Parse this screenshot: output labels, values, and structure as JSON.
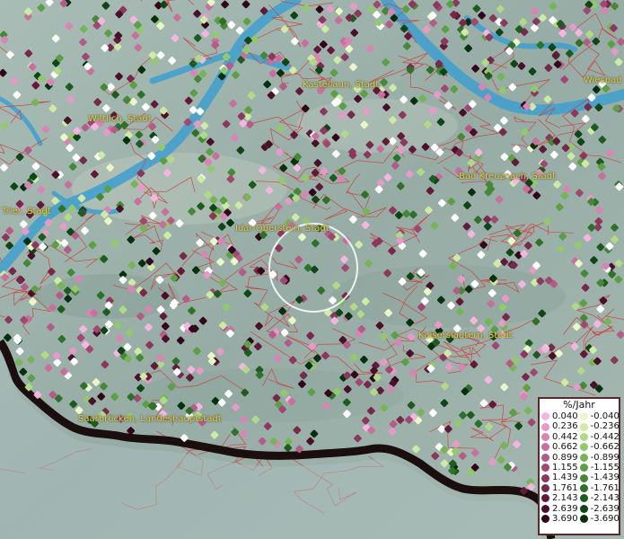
{
  "map": {
    "cities": [
      {
        "label": "Kastellaun, Stadt",
        "name": "city-kastellaun"
      },
      {
        "label": "Wiesbad",
        "name": "city-wiesbaden"
      },
      {
        "label": "Wittlich, Stadt",
        "name": "city-wittlich"
      },
      {
        "label": "Bad Kreuznach, Stadt",
        "name": "city-bad-kreuznach"
      },
      {
        "label": "Trier, Stadt",
        "name": "city-trier"
      },
      {
        "label": "Idar-Oberstein, Stadt",
        "name": "city-idar-oberstein"
      },
      {
        "label": "Kaiserslautern, Stadt",
        "name": "city-kaiserslautern"
      },
      {
        "label": "Saarbrücken, Landeshauptstadt",
        "name": "city-saarbruecken"
      }
    ],
    "colors": {
      "terrain": "#9fb3ad",
      "water": "#3f9fd0",
      "boundaries": "#d23b3b",
      "border": "#1a0e0e",
      "label": "#e8d23a"
    }
  },
  "legend": {
    "title": "%/Jahr",
    "positive": [
      {
        "value": "0.040",
        "color": "#f4b6e0"
      },
      {
        "value": "0.236",
        "color": "#e69ac8"
      },
      {
        "value": "0.442",
        "color": "#d884b4"
      },
      {
        "value": "0.662",
        "color": "#c86f9e"
      },
      {
        "value": "0.899",
        "color": "#b55b88"
      },
      {
        "value": "1.155",
        "color": "#a04872"
      },
      {
        "value": "1.439",
        "color": "#8c375e"
      },
      {
        "value": "1.761",
        "color": "#77284b"
      },
      {
        "value": "2.143",
        "color": "#611b39"
      },
      {
        "value": "2.639",
        "color": "#4a1029"
      },
      {
        "value": "3.690",
        "color": "#32061a"
      }
    ],
    "negative": [
      {
        "value": "-0.040",
        "color": "#eaf7c6"
      },
      {
        "value": "-0.236",
        "color": "#cfeaa4"
      },
      {
        "value": "-0.442",
        "color": "#b1da87"
      },
      {
        "value": "-0.662",
        "color": "#93c96d"
      },
      {
        "value": "-0.899",
        "color": "#76b556"
      },
      {
        "value": "-1.155",
        "color": "#5c9f44"
      },
      {
        "value": "-1.439",
        "color": "#458836"
      },
      {
        "value": "-1.761",
        "color": "#30712a"
      },
      {
        "value": "-2.143",
        "color": "#1e5b1f"
      },
      {
        "value": "-2.639",
        "color": "#104516"
      },
      {
        "value": "-3.690",
        "color": "#05300d"
      }
    ]
  }
}
